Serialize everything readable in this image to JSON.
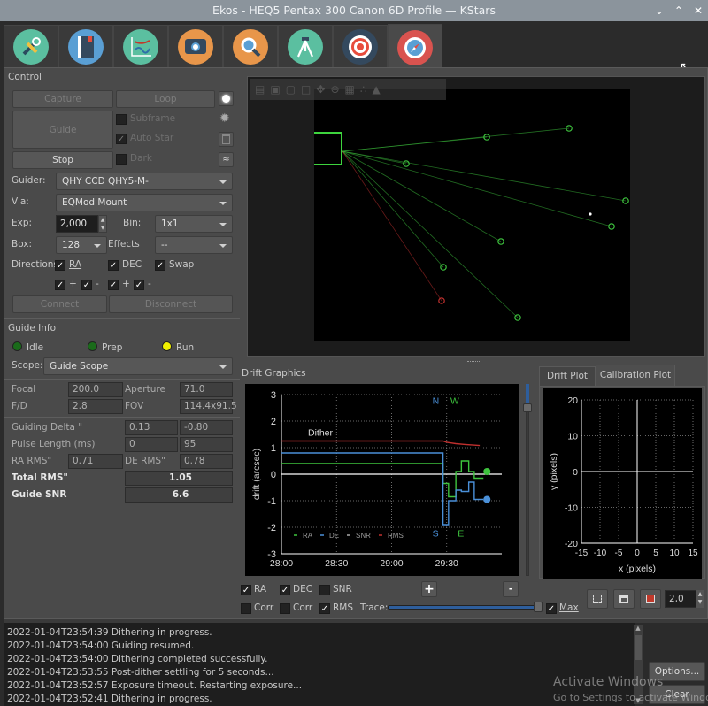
{
  "window": {
    "title": "Ekos - HEQ5 Pentax 300 Canon 6D Profile — KStars",
    "controls": [
      "minimize",
      "maximize",
      "close"
    ]
  },
  "module_tabs": [
    {
      "name": "setup",
      "icon": "wrench-screwdriver-icon",
      "color": "#5bbfa0"
    },
    {
      "name": "scheduler",
      "icon": "notebook-icon",
      "color": "#5a9fd4"
    },
    {
      "name": "analyze",
      "icon": "graph-icon",
      "color": "#5bbfa0"
    },
    {
      "name": "capture",
      "icon": "camera-icon",
      "color": "#e8964a"
    },
    {
      "name": "focus",
      "icon": "magnifier-icon",
      "color": "#e8964a"
    },
    {
      "name": "mount",
      "icon": "tripod-icon",
      "color": "#5bbfa0"
    },
    {
      "name": "align",
      "icon": "target-icon",
      "color": "#34495e"
    },
    {
      "name": "guide",
      "icon": "compass-icon",
      "color": "#d9534f",
      "active": true
    }
  ],
  "control": {
    "title": "Control",
    "capture_label": "Capture",
    "loop_label": "Loop",
    "guide_label": "Guide",
    "stop_label": "Stop",
    "subframe_label": "Subframe",
    "subframe_checked": false,
    "autostar_label": "Auto Star",
    "autostar_checked": true,
    "dark_label": "Dark",
    "dark_checked": false,
    "guider_label": "Guider:",
    "guider_value": "QHY CCD QHY5-M-",
    "via_label": "Via:",
    "via_value": "EQMod Mount",
    "exp_label": "Exp:",
    "exp_value": "2,000",
    "bin_label": "Bin:",
    "bin_value": "1x1",
    "box_label": "Box:",
    "box_value": "128",
    "effects_label": "Effects",
    "effects_value": "--",
    "directions_label": "Directions",
    "ra_label": "RA",
    "dec_label": "DEC",
    "swap_label": "Swap",
    "plus": "+",
    "minus": "-",
    "connect_label": "Connect",
    "disconnect_label": "Disconnect"
  },
  "guide_info": {
    "title": "Guide Info",
    "states": [
      {
        "label": "Idle",
        "color": "#1a6b1a"
      },
      {
        "label": "Prep",
        "color": "#1a6b1a"
      },
      {
        "label": "Run",
        "color": "#f0f000"
      }
    ],
    "scope_label": "Scope:",
    "scope_value": "Guide Scope",
    "focal_label": "Focal",
    "focal_value": "200.0",
    "aperture_label": "Aperture",
    "aperture_value": "71.0",
    "fd_label": "F/D",
    "fd_value": "2.8",
    "fov_label": "FOV",
    "fov_value": "114.4x91.5",
    "delta_label": "Guiding Delta \"",
    "delta_ra": "0.13",
    "delta_de": "-0.80",
    "pulse_label": "Pulse Length (ms)",
    "pulse_ra": "0",
    "pulse_de": "95",
    "ra_rms_label": "RA RMS\"",
    "ra_rms_value": "0.71",
    "de_rms_label": "DE RMS\"",
    "de_rms_value": "0.78",
    "total_rms_label": "Total RMS\"",
    "total_rms_value": "1.05",
    "snr_label": "Guide SNR",
    "snr_value": "6.6"
  },
  "drift_graphics": {
    "title": "Drift Graphics",
    "checks": [
      {
        "label": "RA",
        "checked": true
      },
      {
        "label": "DEC",
        "checked": true
      },
      {
        "label": "SNR",
        "checked": false
      },
      {
        "label": "Corr",
        "checked": false
      },
      {
        "label": "Corr",
        "checked": false
      },
      {
        "label": "RMS",
        "checked": true
      }
    ],
    "zoom_in": "+",
    "zoom_out": "-",
    "trace_label": "Trace:",
    "trace_value": 1.0,
    "max_label": "Max",
    "max_checked": true
  },
  "plot_tabs": [
    {
      "label": "Drift Plot",
      "active": false
    },
    {
      "label": "Calibration Plot",
      "active": true
    }
  ],
  "plot_scale": "2,0",
  "log": {
    "lines": [
      "2022-01-04T23:54:39 Dithering in progress.",
      "2022-01-04T23:54:00 Guiding resumed.",
      "2022-01-04T23:54:00 Dithering completed successfully.",
      "2022-01-04T23:53:55 Post-dither settling for 5 seconds...",
      "2022-01-04T23:52:57 Exposure timeout. Restarting exposure...",
      "2022-01-04T23:52:41 Dithering in progress."
    ],
    "options_label": "Options...",
    "clear_label": "Clear"
  },
  "watermark": {
    "line1": "Activate Windows",
    "line2": "Go to Settings to activate Windows."
  },
  "chart_data": [
    {
      "type": "line",
      "title": "Drift Graphics",
      "xlabel": "",
      "ylabel": "drift (arcsec)",
      "x_ticks": [
        "28:00",
        "28:30",
        "29:00",
        "29:30"
      ],
      "xlim": [
        "28:00",
        "30:00"
      ],
      "ylim": [
        -3,
        3
      ],
      "y_ticks": [
        -3,
        -2,
        -1,
        0,
        1,
        2,
        3
      ],
      "grid": true,
      "annotations": [
        "Dither",
        "N",
        "W",
        "S",
        "E"
      ],
      "legend": [
        "RA",
        "DE",
        "SNR",
        "RMS"
      ],
      "legend_position": "bottom-left",
      "series": [
        {
          "name": "RA",
          "color": "#3ec43e",
          "x": [
            0,
            88,
            88,
            91,
            91,
            95,
            95,
            98,
            98,
            102,
            102,
            105,
            105,
            110,
            110
          ],
          "values": [
            0.4,
            0.4,
            -0.35,
            -0.35,
            -0.85,
            -0.85,
            0.1,
            0.1,
            0.5,
            0.5,
            0.1,
            0.1,
            -0.15,
            -0.15,
            -0.15
          ]
        },
        {
          "name": "DE",
          "color": "#4a90d9",
          "x": [
            0,
            88,
            88,
            91,
            91,
            95,
            95,
            98,
            98,
            102,
            102,
            105,
            105,
            110,
            110
          ],
          "values": [
            0.8,
            0.8,
            -1.9,
            -1.9,
            -1.0,
            -1.0,
            -0.6,
            -0.6,
            -0.65,
            -0.65,
            -0.3,
            -0.3,
            -0.95,
            -0.95,
            -0.95
          ]
        },
        {
          "name": "RMS",
          "color": "#c0302e",
          "x": [
            0,
            88,
            90,
            95,
            100,
            108
          ],
          "values": [
            1.25,
            1.25,
            1.2,
            1.15,
            1.12,
            1.08
          ]
        }
      ]
    },
    {
      "type": "scatter",
      "title": "Calibration Plot",
      "xlabel": "x (pixels)",
      "ylabel": "y (pixels)",
      "xlim": [
        -15,
        15
      ],
      "ylim": [
        -20,
        20
      ],
      "x_ticks": [
        -15,
        -10,
        -5,
        0,
        5,
        10,
        15
      ],
      "y_ticks": [
        -20,
        -10,
        0,
        10,
        20
      ],
      "grid": true,
      "series": []
    }
  ]
}
